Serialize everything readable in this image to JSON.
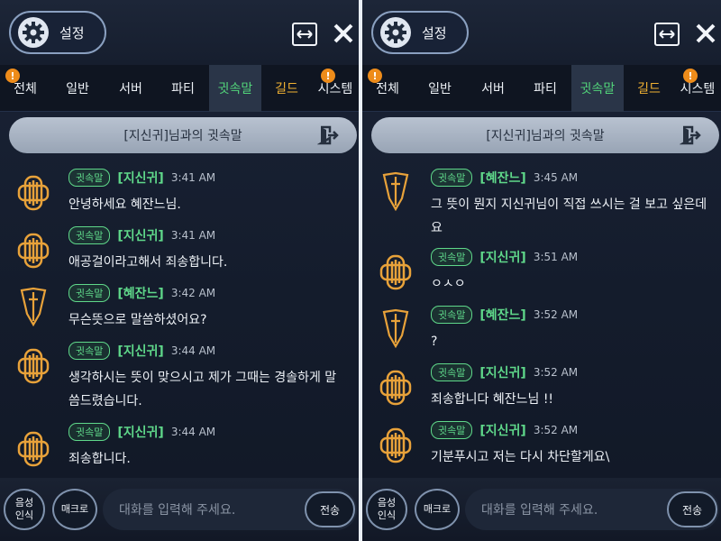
{
  "header": {
    "settings_label": "설정"
  },
  "tabs": [
    {
      "label": "전체",
      "alert": "!"
    },
    {
      "label": "일반"
    },
    {
      "label": "서버"
    },
    {
      "label": "파티"
    },
    {
      "label": "귓속말"
    },
    {
      "label": "길드"
    },
    {
      "label": "시스템",
      "alert": "!"
    }
  ],
  "colors": {
    "whisper_green": "#52d47a",
    "guild_gold": "#f2b233",
    "alert_orange": "#ee8c1a"
  },
  "left": {
    "banner_title": "[지신귀]님과의 귓속말",
    "messages": [
      {
        "tag": "귓속말",
        "sender": "[지신귀]",
        "time": "3:41 AM",
        "text": "안녕하세요 혜잔느님.",
        "avatar": "guild-crest-icon"
      },
      {
        "tag": "귓속말",
        "sender": "[지신귀]",
        "time": "3:41 AM",
        "text": "애공걸이라고해서 죄송합니다.",
        "avatar": "guild-crest-icon"
      },
      {
        "tag": "귓속말",
        "sender": "[혜잔느]",
        "time": "3:42 AM",
        "text": "무슨뜻으로 말씀하셨어요?",
        "avatar": "sword-crest-icon"
      },
      {
        "tag": "귓속말",
        "sender": "[지신귀]",
        "time": "3:44 AM",
        "text": "생각하시는 뜻이 맞으시고 제가 그때는 경솔하게 말씀드렸습니다.",
        "avatar": "guild-crest-icon"
      },
      {
        "tag": "귓속말",
        "sender": "[지신귀]",
        "time": "3:44 AM",
        "text": "죄송합니다.",
        "avatar": "guild-crest-icon"
      }
    ]
  },
  "right": {
    "banner_title": "[지신귀]님과의 귓속말",
    "messages": [
      {
        "tag": "귓속말",
        "sender": "[혜잔느]",
        "time": "3:45 AM",
        "text": "그 뜻이 뭔지 지신귀님이 직접 쓰시는 걸 보고 싶은데요",
        "avatar": "sword-crest-icon"
      },
      {
        "tag": "귓속말",
        "sender": "[지신귀]",
        "time": "3:51 AM",
        "text": "ㅇㅅㅇ",
        "avatar": "guild-crest-icon"
      },
      {
        "tag": "귓속말",
        "sender": "[혜잔느]",
        "time": "3:52 AM",
        "text": "?",
        "avatar": "sword-crest-icon"
      },
      {
        "tag": "귓속말",
        "sender": "[지신귀]",
        "time": "3:52 AM",
        "text": "죄송합니다 혜잔느님 !!",
        "avatar": "guild-crest-icon"
      },
      {
        "tag": "귓속말",
        "sender": "[지신귀]",
        "time": "3:52 AM",
        "text": "기분푸시고  저는 다시 차단할게요\\",
        "avatar": "guild-crest-icon"
      }
    ]
  },
  "bottom": {
    "voice_line1": "음성",
    "voice_line2": "인식",
    "macro_label": "매크로",
    "input_placeholder": "대화를 입력해 주세요.",
    "send_label": "전송"
  }
}
